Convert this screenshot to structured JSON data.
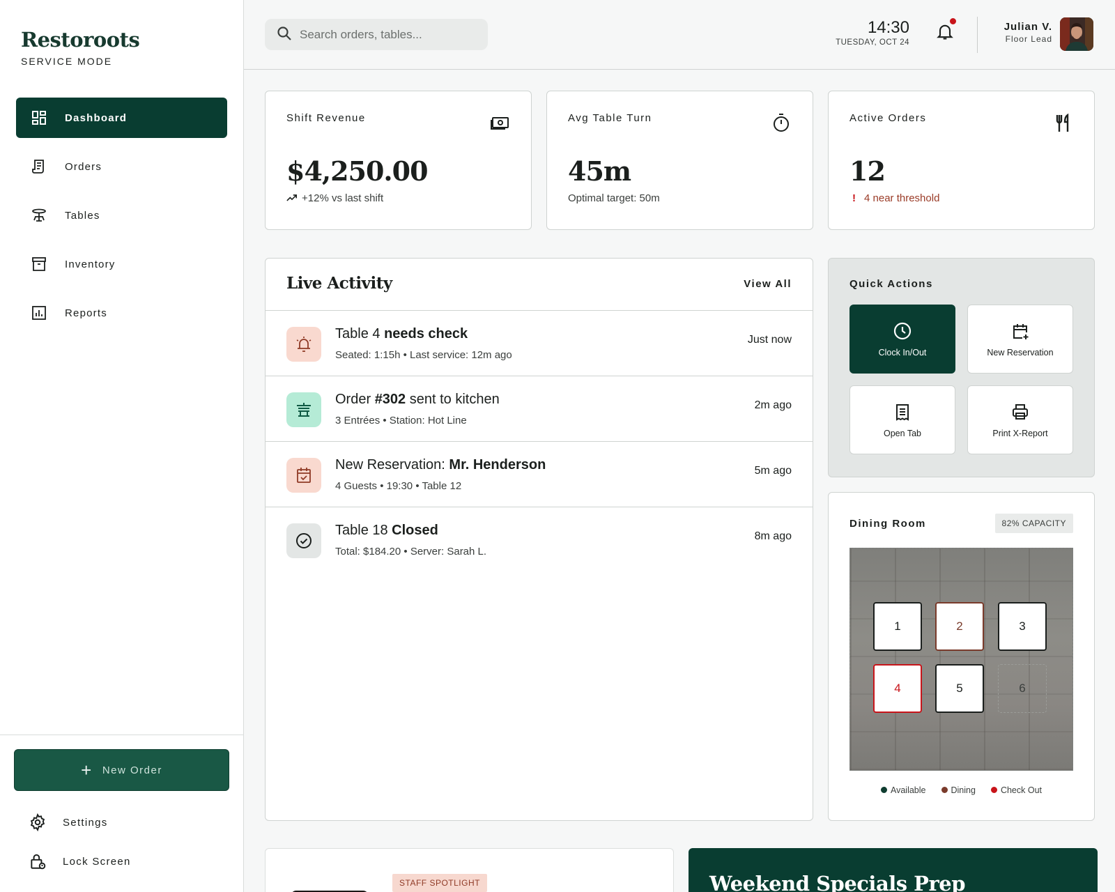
{
  "brand": {
    "name": "Restoroots",
    "mode": "SERVICE MODE"
  },
  "nav": [
    {
      "label": "Dashboard",
      "icon": "dashboard-icon",
      "active": true
    },
    {
      "label": "Orders",
      "icon": "receipt-icon"
    },
    {
      "label": "Tables",
      "icon": "table-icon"
    },
    {
      "label": "Inventory",
      "icon": "archive-box-icon"
    },
    {
      "label": "Reports",
      "icon": "bar-chart-icon"
    }
  ],
  "sidebar_bottom": {
    "new_order": "New Order",
    "settings": "Settings",
    "lock": "Lock Screen"
  },
  "header": {
    "search_placeholder": "Search orders, tables...",
    "time": "14:30",
    "date": "TUESDAY, OCT 24",
    "user_name": "Julian V.",
    "user_role": "Floor Lead"
  },
  "stats": {
    "revenue": {
      "label": "Shift Revenue",
      "value": "$4,250.00",
      "sub": "+12% vs last shift",
      "icon": "cash-icon"
    },
    "turn": {
      "label": "Avg Table Turn",
      "value": "45m",
      "sub": "Optimal target: 50m",
      "icon": "stopwatch-icon"
    },
    "orders": {
      "label": "Active Orders",
      "value": "12",
      "sub": "4 near threshold",
      "sub_prefix": "!",
      "icon": "utensils-icon"
    }
  },
  "live_activity": {
    "title": "Live Activity",
    "view_all": "View All",
    "items": [
      {
        "pre": "Table 4 ",
        "bold": "needs check",
        "post": "",
        "sub": "Seated: 1:15h • Last service: 12m ago",
        "time": "Just now",
        "icon": "bell-alert-icon",
        "accent": "#f9d9cf"
      },
      {
        "pre": "Order ",
        "bold": "#302",
        "post": " sent to kitchen",
        "sub": "3 Entrées • Station: Hot Line",
        "time": "2m ago",
        "icon": "kitchen-icon",
        "accent": "#b5ebd6"
      },
      {
        "pre": "New Reservation: ",
        "bold": "Mr. Henderson",
        "post": "",
        "sub": "4 Guests • 19:30 • Table 12",
        "time": "5m ago",
        "icon": "calendar-check-icon",
        "accent": "#f9d9cf"
      },
      {
        "pre": "Table 18 ",
        "bold": "Closed",
        "post": "",
        "sub": "Total: $184.20 • Server: Sarah L.",
        "time": "8m ago",
        "icon": "check-circle-icon",
        "accent": "#e3e6e5"
      }
    ]
  },
  "quick_actions": {
    "title": "Quick Actions",
    "items": [
      {
        "label": "Clock In/Out",
        "icon": "clock-icon"
      },
      {
        "label": "New Reservation",
        "icon": "calendar-plus-icon"
      },
      {
        "label": "Open Tab",
        "icon": "receipt-long-icon"
      },
      {
        "label": "Print X-Report",
        "icon": "printer-icon"
      }
    ]
  },
  "dining_room": {
    "title": "Dining Room",
    "capacity": "82% CAPACITY",
    "tables": [
      {
        "number": "1",
        "status": "available"
      },
      {
        "number": "2",
        "status": "dining"
      },
      {
        "number": "3",
        "status": "available"
      },
      {
        "number": "4",
        "status": "checkout"
      },
      {
        "number": "5",
        "status": "available"
      },
      {
        "number": "6",
        "status": "empty"
      }
    ],
    "legend": [
      {
        "label": "Available",
        "color": "#0f3d30"
      },
      {
        "label": "Dining",
        "color": "#7a3b2b"
      },
      {
        "label": "Check Out",
        "color": "#c8141a"
      }
    ]
  },
  "bottom": {
    "spotlight_badge": "STAFF SPOTLIGHT",
    "weekend_title": "Weekend Specials Prep"
  },
  "colors": {
    "accent": "#093d31",
    "alert": "#c8141a",
    "warn": "#9a3b27"
  }
}
